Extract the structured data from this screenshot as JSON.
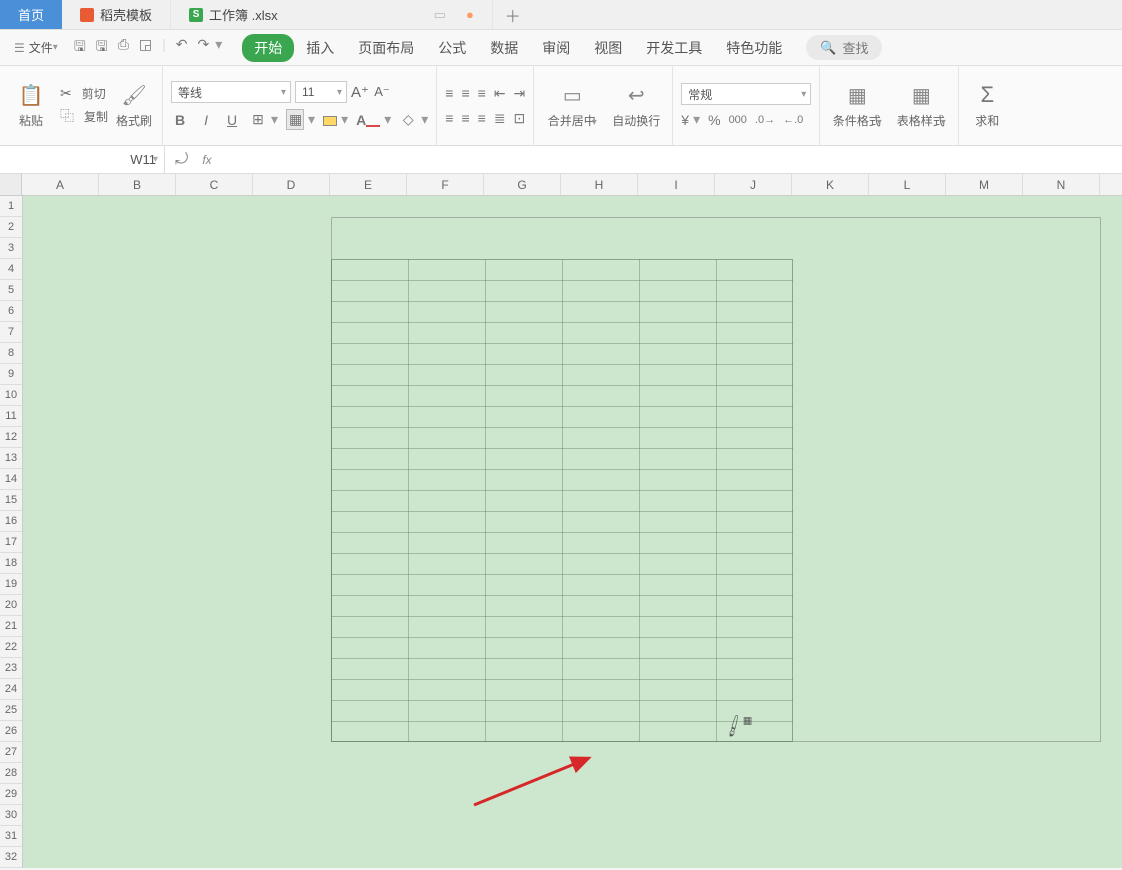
{
  "tabs": {
    "home": "首页",
    "doku": "稻壳模板",
    "file": "工作簿 .xlsx"
  },
  "menu": {
    "file": "文件",
    "items": [
      "开始",
      "插入",
      "页面布局",
      "公式",
      "数据",
      "审阅",
      "视图",
      "开发工具",
      "特色功能"
    ],
    "search": "查找"
  },
  "ribbon": {
    "paste": "粘贴",
    "cut": "剪切",
    "copy": "复制",
    "fmtpainter": "格式刷",
    "font": "等线",
    "size": "11",
    "merge": "合并居中",
    "wrap": "自动换行",
    "numfmt": "常规",
    "condfmt": "条件格式",
    "tblstyle": "表格样式",
    "sum": "求和"
  },
  "namebox": "W11",
  "columns": [
    "A",
    "B",
    "C",
    "D",
    "E",
    "F",
    "G",
    "H",
    "I",
    "J",
    "K",
    "L",
    "M",
    "N"
  ],
  "rows": [
    "1",
    "2",
    "3",
    "4",
    "5",
    "6",
    "7",
    "8",
    "9",
    "10",
    "11",
    "12",
    "13",
    "14",
    "15",
    "16",
    "17",
    "18",
    "19",
    "20",
    "21",
    "22",
    "23",
    "24",
    "25",
    "26",
    "27",
    "28",
    "29",
    "30",
    "31",
    "32"
  ]
}
